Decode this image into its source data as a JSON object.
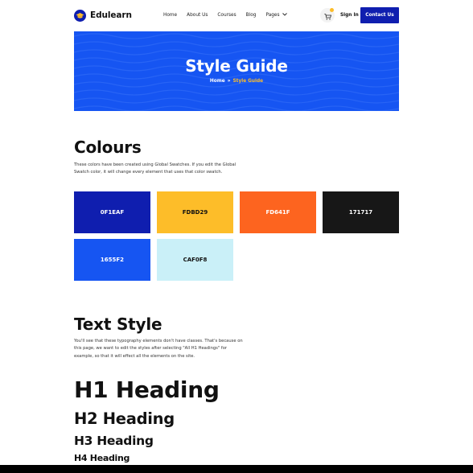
{
  "header": {
    "logo_text": "Edulearn",
    "nav": [
      {
        "label": "Home"
      },
      {
        "label": "About Us"
      },
      {
        "label": "Courses"
      },
      {
        "label": "Blog"
      },
      {
        "label": "Pages"
      }
    ],
    "signin_label": "Sign In",
    "contact_label": "Contact Us",
    "icons": [
      "graduation-cap-icon",
      "cart-icon",
      "chevron-down-icon"
    ]
  },
  "banner": {
    "title": "Style Guide",
    "breadcrumb": {
      "home": "Home",
      "separator": "»",
      "current": "Style Guide"
    }
  },
  "colours": {
    "title": "Colours",
    "description": "These colors have been created using Global Swatches. If you edit the Global Swatch color, it will change every element that uses that color swatch.",
    "swatches": [
      {
        "label": "0F1EAF",
        "color": "#0F1EAF",
        "text_color": "#ffffff"
      },
      {
        "label": "FDBD29",
        "color": "#FDBD29",
        "text_color": "#111111"
      },
      {
        "label": "FD641F",
        "color": "#FD641F",
        "text_color": "#ffffff"
      },
      {
        "label": "171717",
        "color": "#171717",
        "text_color": "#ffffff"
      },
      {
        "label": "1655F2",
        "color": "#1655F2",
        "text_color": "#ffffff"
      },
      {
        "label": "CAF0F8",
        "color": "#CAF0F8",
        "text_color": "#111111"
      }
    ]
  },
  "text_style": {
    "title": "Text Style",
    "description": "You'll see that these typography elements don't have classes. That's because on this page, we want to edit the styles after selecting \"All H1 Headings\" for example, so that it will effect all the elements on the site.",
    "h1": "H1 Heading",
    "h2": "H2 Heading",
    "h3": "H3 Heading",
    "h4": "H4 Heading"
  },
  "theme": {
    "primary": "#0F1EAF",
    "accent": "#FDBD29",
    "banner": "#1655F2"
  }
}
